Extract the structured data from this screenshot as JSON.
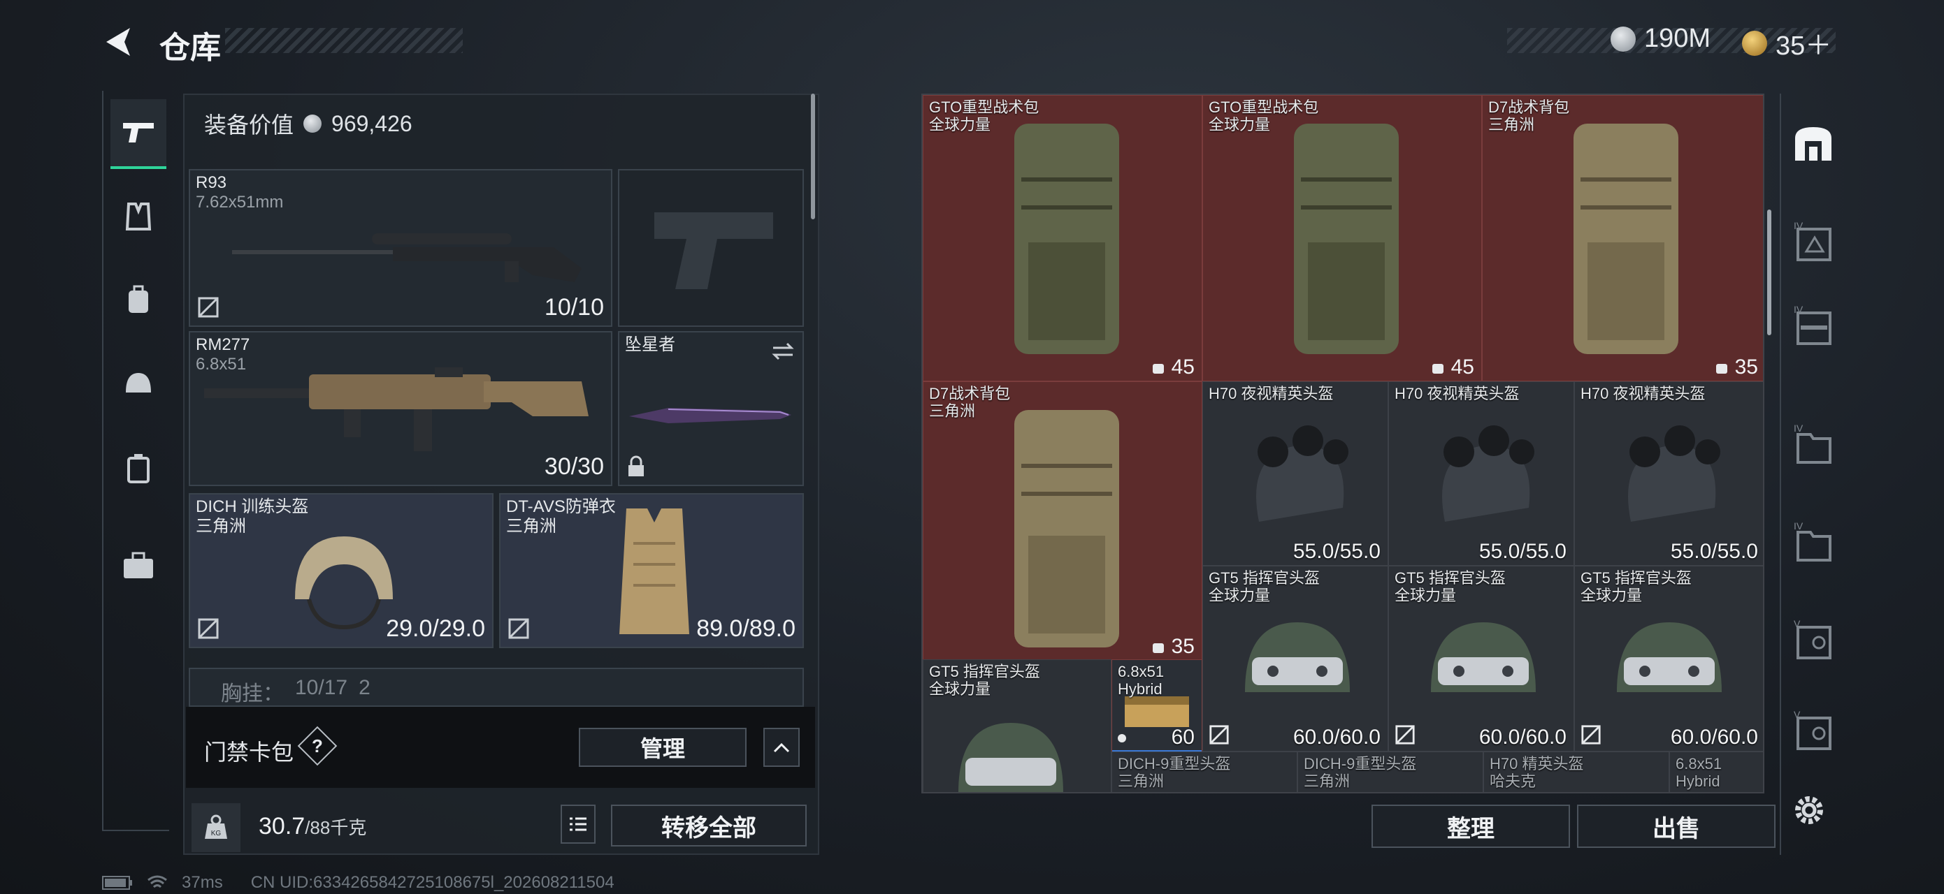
{
  "header": {
    "title": "仓库"
  },
  "currency": {
    "silver": "190M",
    "gold": "35＋"
  },
  "equipment": {
    "value_label": "装备价值",
    "value": "969,426",
    "primary": {
      "name": "R93",
      "caliber": "7.62x51mm",
      "ammo": "10/10"
    },
    "secondary": {
      "name": "RM277",
      "caliber": "6.8x51",
      "ammo": "30/30"
    },
    "melee": {
      "name": "坠星者"
    },
    "helmet": {
      "name": "DICH 训练头盔",
      "maker": "三角洲",
      "durability": "29.0/29.0"
    },
    "armor": {
      "name": "DT-AVS防弹衣",
      "maker": "三角洲",
      "durability": "89.0/89.0"
    },
    "chest_rig": {
      "label": "胸挂：",
      "value": "10/17",
      "extra": "2"
    }
  },
  "keycard": {
    "label": "门禁卡包",
    "help": "?",
    "manage": "管理"
  },
  "footer": {
    "weight": "30.7",
    "capacity": "/88千克",
    "kg_icon": "KG",
    "transfer_all": "转移全部"
  },
  "storage": {
    "row1": [
      {
        "name": "GTO重型战术包",
        "maker": "全球力量",
        "cap": "45"
      },
      {
        "name": "GTO重型战术包",
        "maker": "全球力量",
        "cap": "45"
      },
      {
        "name": "D7战术背包",
        "maker": "三角洲",
        "cap": "35"
      }
    ],
    "d7": {
      "name": "D7战术背包",
      "maker": "三角洲",
      "cap": "35"
    },
    "h70": [
      {
        "name": "H70 夜视精英头盔",
        "val": "55.0/55.0"
      },
      {
        "name": "H70 夜视精英头盔",
        "val": "55.0/55.0"
      },
      {
        "name": "H70 夜视精英头盔",
        "val": "55.0/55.0"
      }
    ],
    "gt5": [
      {
        "name": "GT5 指挥官头盔",
        "maker": "全球力量",
        "val": "60.0/60.0"
      },
      {
        "name": "GT5 指挥官头盔",
        "maker": "全球力量",
        "val": "60.0/60.0"
      },
      {
        "name": "GT5 指挥官头盔",
        "maker": "全球力量",
        "val": "60.0/60.0"
      }
    ],
    "gt5b": {
      "name": "GT5 指挥官头盔",
      "maker": "全球力量"
    },
    "ammo": {
      "name": "6.8x51",
      "maker": "Hybrid",
      "count": "60"
    },
    "row5": [
      {
        "name": "DICH-9重型头盔",
        "maker": "三角洲"
      },
      {
        "name": "DICH-9重型头盔",
        "maker": "三角洲"
      },
      {
        "name": "H70 精英头盔",
        "maker": "哈夫克"
      },
      {
        "name": "6.8x51",
        "maker": "Hybrid"
      }
    ],
    "sort": "整理",
    "sell": "出售"
  },
  "right_rail": [
    "IV",
    "IV",
    "IV",
    "IV",
    "V",
    "V"
  ],
  "status": {
    "ping": "37ms",
    "uid": "CN UID:6334265842725108675l_202608211504"
  }
}
